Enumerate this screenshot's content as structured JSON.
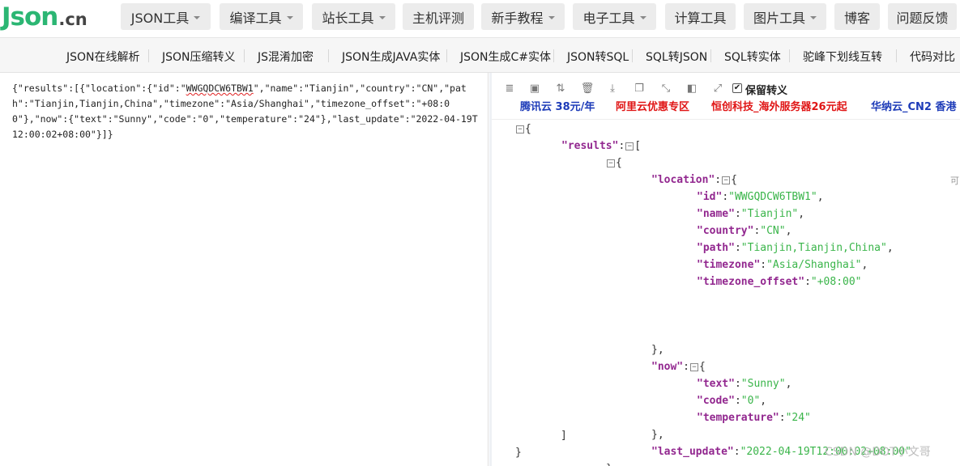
{
  "logo": {
    "main": "Json",
    "suffix": ".cn"
  },
  "nav": [
    {
      "label": "JSON工具",
      "caret": true
    },
    {
      "label": "编译工具",
      "caret": true
    },
    {
      "label": "站长工具",
      "caret": true
    },
    {
      "label": "主机评测",
      "caret": false
    },
    {
      "label": "新手教程",
      "caret": true
    },
    {
      "label": "电子工具",
      "caret": true
    },
    {
      "label": "计算工具",
      "caret": false
    },
    {
      "label": "图片工具",
      "caret": true
    },
    {
      "label": "博客",
      "caret": false
    },
    {
      "label": "问题反馈",
      "caret": false
    }
  ],
  "subnav": [
    "JSON在线解析",
    "JSON压缩转义",
    "JS混淆加密",
    "JSON生成JAVA实体",
    "JSON生成C#实体",
    "JSON转SQL",
    "SQL转JSON",
    "SQL转实体",
    "驼峰下划线互转",
    "代码对比"
  ],
  "editor": {
    "raw_before": "{\"results\":[{\"location\":{\"id\":\"",
    "raw_id": "WWGQDCW6TBW1",
    "raw_after": "\",\"name\":\"Tianjin\",\"country\":\"CN\",\"path\":\"Tianjin,Tianjin,China\",\"timezone\":\"Asia/Shanghai\",\"timezone_offset\":\"+08:00\"},\"now\":{\"text\":\"Sunny\",\"code\":\"0\",\"temperature\":\"24\"},\"last_update\":\"2022-04-19T12:00:02+08:00\"}]}"
  },
  "toolbar": {
    "icons": [
      "database-icon",
      "excel-icon",
      "sort-icon",
      "trash-icon",
      "download-icon",
      "copy-icon",
      "collapse-icon",
      "compress-icon",
      "expand-icon"
    ],
    "checkbox_label": "保留转义",
    "checkbox_checked": true
  },
  "ads": [
    {
      "text": "腾讯云 38元/年",
      "color": "#1d3bb8"
    },
    {
      "text": "阿里云优惠专区",
      "color": "#e01515"
    },
    {
      "text": "恒创科技_海外服务器26元起",
      "color": "#e01515"
    },
    {
      "text": "华纳云_CN2 香港",
      "color": "#1d3bb8"
    }
  ],
  "tree": {
    "results_key": "\"results\"",
    "location_key": "\"location\"",
    "now_key": "\"now\"",
    "last_update_key": "\"last_update\"",
    "last_update_val": "\"2022-04-19T12:00:02+08:00\"",
    "location_fields": [
      {
        "key": "\"id\"",
        "value": "\"WWGQDCW6TBW1\""
      },
      {
        "key": "\"name\"",
        "value": "\"Tianjin\""
      },
      {
        "key": "\"country\"",
        "value": "\"CN\""
      },
      {
        "key": "\"path\"",
        "value": "\"Tianjin,Tianjin,China\""
      },
      {
        "key": "\"timezone\"",
        "value": "\"Asia/Shanghai\""
      },
      {
        "key": "\"timezone_offset\"",
        "value": "\"+08:00\""
      }
    ],
    "now_fields": [
      {
        "key": "\"text\"",
        "value": "\"Sunny\""
      },
      {
        "key": "\"code\"",
        "value": "\"0\""
      },
      {
        "key": "\"temperature\"",
        "value": "\"24\""
      }
    ]
  },
  "edge_char": "可",
  "watermark": "CSDN @DOT小文哥"
}
